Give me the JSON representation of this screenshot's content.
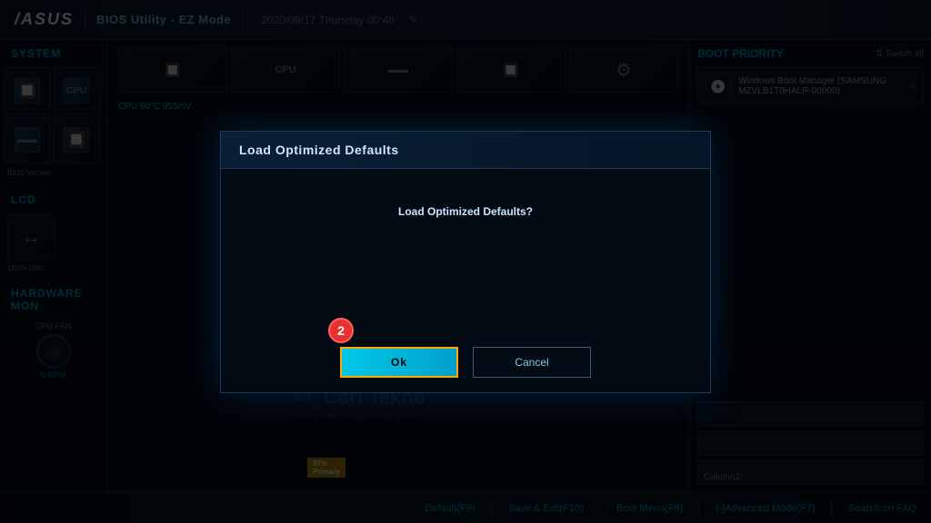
{
  "header": {
    "logo": "/SUS",
    "title": "BIOS Utility - EZ Mode",
    "datetime": "2020/09/17  Thursday  00:46",
    "edit_icon": "✎"
  },
  "system": {
    "section_label": "System",
    "icons": [
      {
        "id": "motherboard",
        "symbol": "🔲"
      },
      {
        "id": "cpu",
        "symbol": "🖥"
      },
      {
        "id": "memory",
        "symbol": "▬"
      },
      {
        "id": "storage",
        "symbol": "🔲"
      },
      {
        "id": "settings",
        "symbol": "⚙"
      }
    ],
    "bios_version_label": "BIOS Version:"
  },
  "lcd": {
    "section_label": "LCD",
    "resolution": "1920×1080",
    "icon": "↔"
  },
  "hardware_mon": {
    "section_label": "Hardware Mon",
    "cpu_fan_label": "CPU FAN",
    "fan_icon": "◎",
    "rpm": "0 RPM"
  },
  "cpu_info": {
    "temp": "CPU  60°C  955mV"
  },
  "boot_priority": {
    "title": "Boot Priority",
    "switch_all": "⇅ Switch all",
    "items": [
      {
        "name": "Windows Boot Manager (SAMSUNG MZVLB1T0HALR-00000)",
        "icon": "💿"
      }
    ],
    "column2_label": "Column2:"
  },
  "modal": {
    "title": "Load Optimized Defaults",
    "question": "Load Optimized Defaults?",
    "ok_label": "Ok",
    "cancel_label": "Cancel",
    "step_number": "2"
  },
  "footer": {
    "items": [
      {
        "label": "Default(F9)",
        "key": "Default",
        "shortcut": "F9"
      },
      {
        "label": "Save & Exit(F10)",
        "key": "Save & Exit",
        "shortcut": "F10"
      },
      {
        "label": "Boot Menu(F8)",
        "key": "Boot Menu",
        "shortcut": "F8"
      },
      {
        "label": "|-]Advanced Mode(F7)",
        "key": "Advanced Mode",
        "shortcut": "F7"
      },
      {
        "label": "Search on FAQ",
        "key": "Search on FAQ",
        "shortcut": ""
      }
    ],
    "separator": "|"
  },
  "watermark": {
    "line1": "Cari Tekno",
    "line2": "Situs Teknologi Paling Detail"
  }
}
